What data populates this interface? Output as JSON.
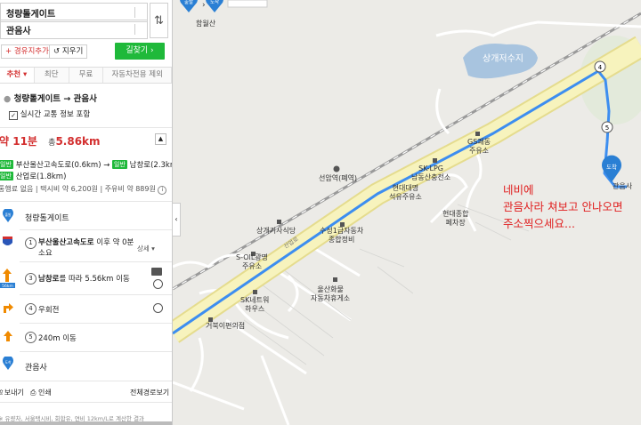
{
  "search": {
    "origin": "청량톨게이트",
    "destination": "관음사",
    "add_waypoint": "+ 경유지추가",
    "clear": "↺ 지우기",
    "find_route": "길찾기 ›",
    "swap_icon": "⇅"
  },
  "tabs": [
    {
      "label": "추천 ▾",
      "active": true
    },
    {
      "label": "최단",
      "active": false
    },
    {
      "label": "무료",
      "active": false
    },
    {
      "label": "자동차전용 제외",
      "active": false
    }
  ],
  "route": {
    "title": "청량톨게이트 → 관음사",
    "realtime_label": "실시간 교통 정보 포함",
    "time": "약 11분",
    "distance_prefix": "총",
    "distance": "5.86km",
    "roads_line1_a": "부산울산고속도로(0.6km) →",
    "roads_line1_b": "남창로(2.3km) →",
    "roads_line2": "산업로(1.8km)",
    "badge_highway": "일반",
    "badge_general": "일반",
    "badge_road3": "일반",
    "cost_line": "통행료 없음 | 택시비 약 6,200원 | 주유비 약 889원"
  },
  "steps": {
    "start_label": "청량톨게이트",
    "start_icon": "출발",
    "step1_num": "1",
    "step1_text_a": "부산울산고속도로",
    "step1_text_b": " 이후 약 0분",
    "step1_text_c": "소요",
    "step1_detail": "상세 ▾",
    "step2_num": "3",
    "step2_bold": "남창로",
    "step2_text": "를 따라 5.56km 이동",
    "step2_dist": "56km",
    "step3_num": "4",
    "step3_text": "우회전",
    "step4_num": "5",
    "step4_text": "240m 이동",
    "end_label": "관음사",
    "end_icon": "도착"
  },
  "footer": {
    "send": "보내기",
    "print": "인쇄",
    "full_route": "전체경로보기 ›",
    "disclaimer": "※ 유량차, 서울택시비, 회합유, 연비 12km/L로 계산한 결과"
  },
  "map": {
    "labels": {
      "hamwolsan": "함월산",
      "reservoir": "상개저수지",
      "gs_station": "GS쾌동\n주유소",
      "sk_lpg": "SK-LPG\n남동산충전소",
      "hyundai_gas": "현대대명\n석유주유소",
      "hyundai_truck": "현대종합\n페차장",
      "seonam_station": "선암역(폐역)",
      "suseong": "수성1급자동차\n종합정비",
      "restaurant": "상개기사식당",
      "s_oil": "S-OIL광명\n주유소",
      "sk_network": "SK네트워\n하우스",
      "ulsan_freight": "울산화물\n자동차휴게소",
      "geobuk": "거북이편의점",
      "gwaneumsa": "관음사",
      "road_name": "산업로",
      "end_pin": "도착",
      "start_pin": "출발",
      "waypoint_4": "4",
      "waypoint_5": "5",
      "turn_arrow": "›"
    },
    "note": [
      "네비에",
      "관음사라 쳐보고 안나오면",
      "주소찍으세요..."
    ]
  },
  "colors": {
    "route": "#3d8ef0",
    "road": "#f5f0b0",
    "accent_red": "#e02020",
    "green": "#1fb93a"
  }
}
